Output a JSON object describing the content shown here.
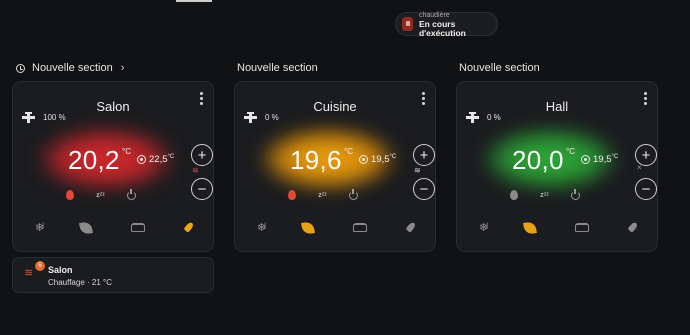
{
  "chip": {
    "title": "chaudière",
    "state": "En cours d'exécution"
  },
  "sections": [
    {
      "title": "Nouvelle section",
      "chevron": "›"
    },
    {
      "title": "Nouvelle section"
    },
    {
      "title": "Nouvelle section"
    }
  ],
  "thermostats": [
    {
      "name": "Salon",
      "valve": "100 %",
      "current": "20,2",
      "unit": "°C",
      "target": "22,5",
      "target_unit": "°C",
      "hvac": "heat",
      "glow_color": "#d4262a",
      "preset_active": "boost",
      "action_icon": "≋"
    },
    {
      "name": "Cuisine",
      "valve": "0 %",
      "current": "19,6",
      "unit": "°C",
      "target": "19,5",
      "target_unit": "°C",
      "hvac": "heat",
      "glow_color": "#e8a010",
      "preset_active": "eco",
      "action_icon": "≋"
    },
    {
      "name": "Hall",
      "valve": "0 %",
      "current": "20,0",
      "unit": "°C",
      "target": "19,5",
      "target_unit": "°C",
      "hvac": "off",
      "glow_color": "#2fa83a",
      "preset_active": "eco",
      "action_icon": "×"
    }
  ],
  "mode_icons": {
    "off_label": "zᶻᶻ"
  },
  "controls": {
    "plus": "+",
    "minus": "−"
  },
  "mini_card": {
    "badge": "6",
    "name": "Salon",
    "state": "Chauffage · 21 °C"
  }
}
